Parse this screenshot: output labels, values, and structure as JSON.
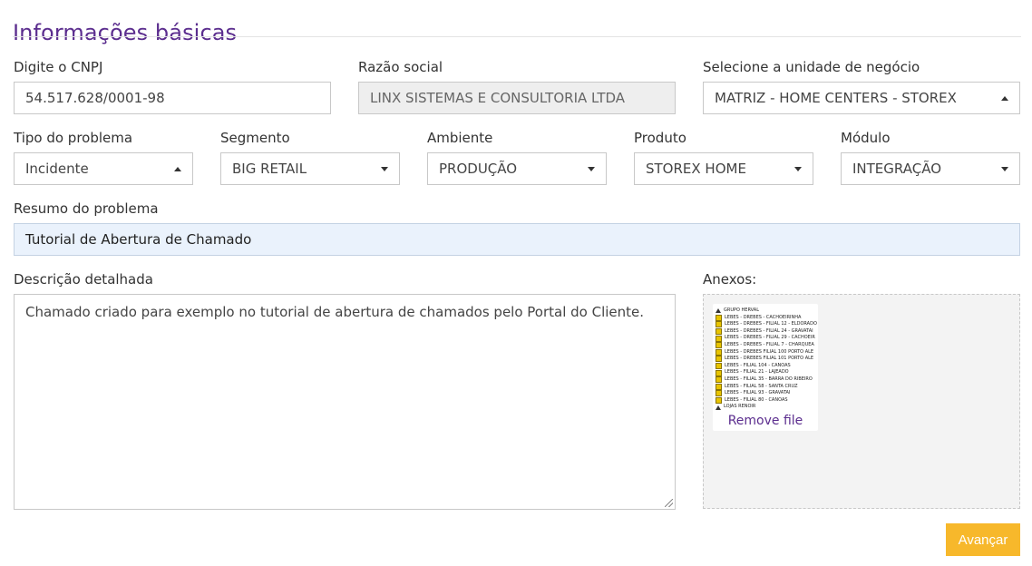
{
  "section": {
    "title": "Informações básicas"
  },
  "cnpj": {
    "label": "Digite o CNPJ",
    "value": "54.517.628/0001-98"
  },
  "razao_social": {
    "label": "Razão social",
    "value": "LINX SISTEMAS E CONSULTORIA LTDA"
  },
  "unidade": {
    "label": "Selecione a unidade de negócio",
    "value": "MATRIZ - HOME CENTERS - STOREX"
  },
  "tipo_problema": {
    "label": "Tipo do problema",
    "value": "Incidente"
  },
  "segmento": {
    "label": "Segmento",
    "value": "BIG RETAIL"
  },
  "ambiente": {
    "label": "Ambiente",
    "value": "PRODUÇÃO"
  },
  "produto": {
    "label": "Produto",
    "value": "STOREX HOME"
  },
  "modulo": {
    "label": "Módulo",
    "value": "INTEGRAÇÃO"
  },
  "resumo": {
    "label": "Resumo do problema",
    "value": "Tutorial de Abertura de Chamado"
  },
  "descricao": {
    "label": "Descrição detalhada",
    "value": "Chamado criado para exemplo no tutorial de abertura de chamados pelo Portal do Cliente."
  },
  "anexos": {
    "label": "Anexos:",
    "remove_label": "Remove file",
    "thumbnail_rows": [
      "GRUPO HERVAL",
      "LEBES - DREBES - CACHOEIRINHA",
      "LEBES - DREBES - FILIAL 12 - ELDORADO",
      "LEBES - DREBES - FILIAL 24 - GRAVATAI",
      "LEBES - DREBES - FILIAL 29 - CACHOEIR",
      "LEBES - DREBES - FILIAL 7 - CHARQUEA",
      "LEBES - DREBES FILIAL 100 PORTO ALE",
      "LEBES - DREBES FILIAL 101 PORTO ALE",
      "LEBES - FILIAL 104 - CANOAS",
      "LEBES - FILIAL 21 - LAJEADO",
      "LEBES - FILIAL 35 - BARRA DO RIBEIRO",
      "LEBES - FILIAL 58 - SANTA CRUZ",
      "LEBES - FILIAL 93 - GRAVATAI",
      "LEBES - FILIAL 80 - CANOAS",
      "LOJAS RENOIR"
    ]
  },
  "actions": {
    "submit_label": "Avançar"
  },
  "colors": {
    "accent": "#5b2d8e",
    "button": "#f7b82b",
    "highlight_field": "#eaf2fc"
  },
  "icons": {
    "dropdown": "caret-icon",
    "checkbox": "checkbox-icon",
    "resize": "resize-grip-icon"
  }
}
